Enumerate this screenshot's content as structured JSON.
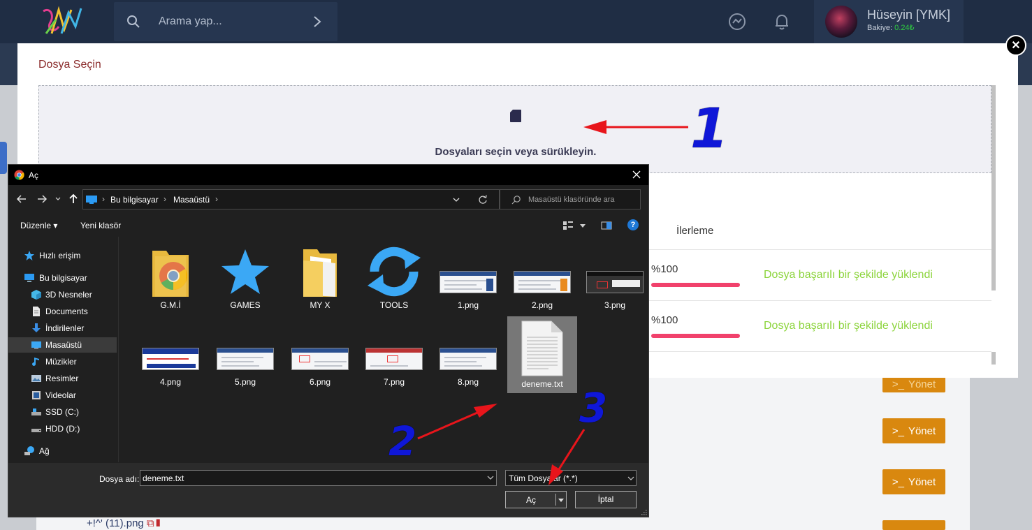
{
  "site": {
    "search_placeholder": "Arama yap...",
    "user_name": "Hüseyin [YMK]",
    "balance_label": "Bakiye:",
    "balance_value": "0.24₺",
    "manage_label": "Yönet",
    "bg_file_name": "+!^' (11).png"
  },
  "modal": {
    "title": "Dosya Seçin",
    "dropzone_text": "Dosyaları seçin veya sürükleyin.",
    "progress_header": "İlerleme",
    "rows": [
      {
        "percent_text": "%100",
        "progress": 1.0,
        "message": "Dosya başarılı bir şekilde yüklendi"
      },
      {
        "percent_text": "%100",
        "progress": 1.0,
        "message": "Dosya başarılı bir şekilde yüklendi"
      }
    ]
  },
  "dialog": {
    "title": "Aç",
    "breadcrumb": [
      "Bu bilgisayar",
      "Masaüstü"
    ],
    "search_placeholder": "Masaüstü klasöründe ara",
    "toolbar": {
      "organize": "Düzenle",
      "new_folder": "Yeni klasör"
    },
    "sidebar": [
      {
        "label": "Hızlı erişim",
        "icon": "star-icon"
      },
      {
        "label": "Bu bilgisayar",
        "icon": "computer-icon"
      },
      {
        "label": "3D Nesneler",
        "icon": "cube-icon"
      },
      {
        "label": "Documents",
        "icon": "document-icon"
      },
      {
        "label": "İndirilenler",
        "icon": "download-icon"
      },
      {
        "label": "Masaüstü",
        "icon": "desktop-icon",
        "selected": true
      },
      {
        "label": "Müzikler",
        "icon": "music-icon"
      },
      {
        "label": "Resimler",
        "icon": "pictures-icon"
      },
      {
        "label": "Videolar",
        "icon": "video-icon"
      },
      {
        "label": "SSD (C:)",
        "icon": "drive-icon"
      },
      {
        "label": "HDD (D:)",
        "icon": "drive-icon"
      },
      {
        "label": "Ağ",
        "icon": "network-icon"
      }
    ],
    "files": [
      {
        "name": "G.M.İ",
        "kind": "chrome-folder"
      },
      {
        "name": "GAMES",
        "kind": "star"
      },
      {
        "name": "MY X",
        "kind": "folder"
      },
      {
        "name": "TOOLS",
        "kind": "sync"
      },
      {
        "name": "1.png",
        "kind": "image"
      },
      {
        "name": "2.png",
        "kind": "image"
      },
      {
        "name": "3.png",
        "kind": "image-dark"
      },
      {
        "name": "4.png",
        "kind": "image-banner"
      },
      {
        "name": "5.png",
        "kind": "image"
      },
      {
        "name": "6.png",
        "kind": "image"
      },
      {
        "name": "7.png",
        "kind": "image-red"
      },
      {
        "name": "8.png",
        "kind": "image"
      },
      {
        "name": "deneme.txt",
        "kind": "text",
        "selected": true
      }
    ],
    "filename_label": "Dosya adı:",
    "filename_value": "deneme.txt",
    "filetype": "Tüm Dosyalar (*.*)",
    "open_label": "Aç",
    "cancel_label": "İptal"
  },
  "annotations": {
    "step1": "1",
    "step2": "2",
    "step3": "3"
  },
  "colors": {
    "accent_red": "#e8151b",
    "annotation_blue": "#0f17d8",
    "success_green": "#8cd43c",
    "progress_pink": "#f1416c",
    "manage_orange": "#d9880f"
  }
}
